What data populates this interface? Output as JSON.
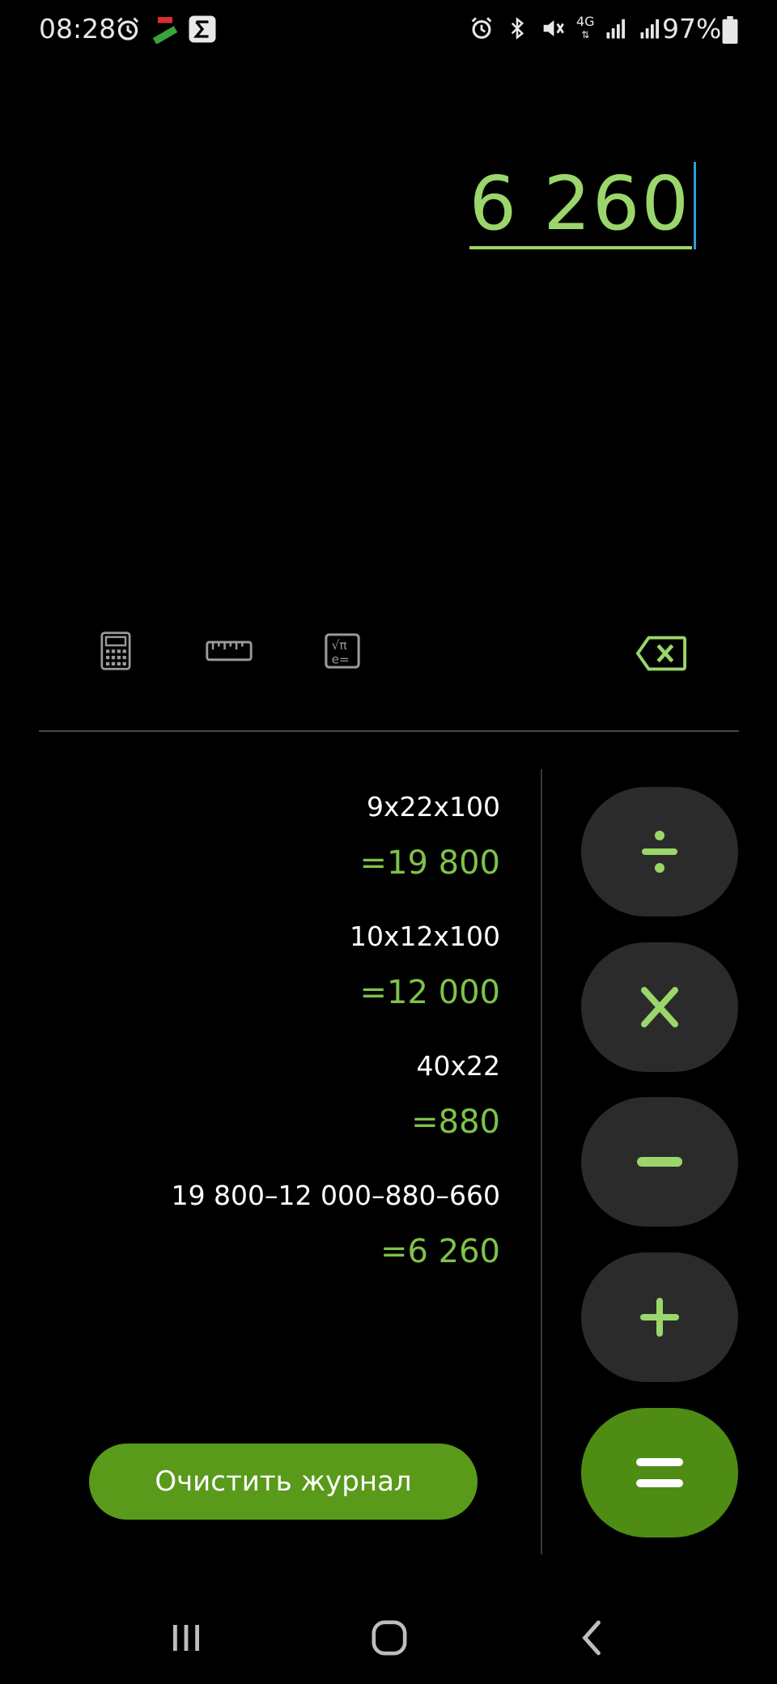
{
  "status_bar": {
    "time": "08:28",
    "battery": "97%",
    "network": "4G",
    "left_icons": [
      "alarm-icon",
      "fake-gps-icon",
      "sigma-icon"
    ],
    "right_icons": [
      "alarm-icon",
      "bluetooth-icon",
      "mute-icon",
      "network-4g-icon",
      "signal-icon",
      "signal-icon",
      "battery-icon"
    ]
  },
  "display": {
    "value": "6 260"
  },
  "toolbar": {
    "icons": [
      "calculator-icon",
      "ruler-icon",
      "scientific-icon",
      "backspace-icon"
    ]
  },
  "history": [
    {
      "expression": "9x22x100",
      "result": "=19 800"
    },
    {
      "expression": "10x12x100",
      "result": "=12 000"
    },
    {
      "expression": "40x22",
      "result": "=880"
    },
    {
      "expression": "19 800–12 000–880–660",
      "result": "=6 260"
    }
  ],
  "clear_history_label": "Очистить журнал",
  "operators": {
    "divide": "÷",
    "multiply": "×",
    "subtract": "−",
    "add": "+",
    "equals": "="
  },
  "colors": {
    "accent": "#7fc24a",
    "display": "#9bd66b",
    "equals_bg": "#4e8c14",
    "clear_bg": "#5a9a1a",
    "operator_bg": "#2b2b2b"
  }
}
